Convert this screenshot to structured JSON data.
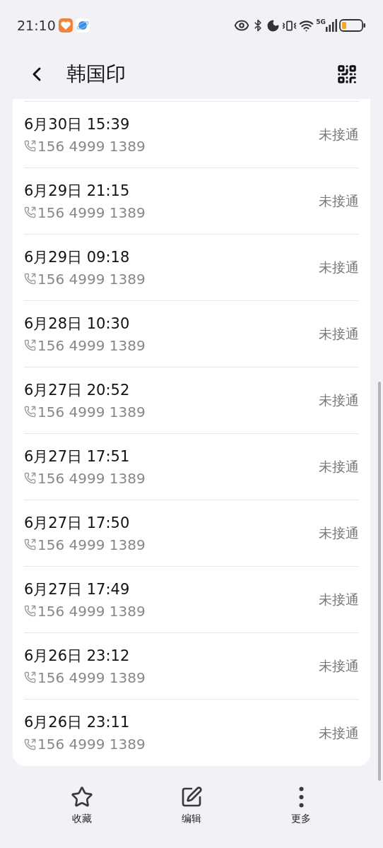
{
  "status_bar": {
    "time": "21:10",
    "network": "5G"
  },
  "header": {
    "title": "韩国印"
  },
  "calls": [
    {
      "date_time": "6月30日 15:39",
      "number": "156 4999 1389",
      "status": "未接通"
    },
    {
      "date_time": "6月29日 21:15",
      "number": "156 4999 1389",
      "status": "未接通"
    },
    {
      "date_time": "6月29日 09:18",
      "number": "156 4999 1389",
      "status": "未接通"
    },
    {
      "date_time": "6月28日 10:30",
      "number": "156 4999 1389",
      "status": "未接通"
    },
    {
      "date_time": "6月27日 20:52",
      "number": "156 4999 1389",
      "status": "未接通"
    },
    {
      "date_time": "6月27日 17:51",
      "number": "156 4999 1389",
      "status": "未接通"
    },
    {
      "date_time": "6月27日 17:50",
      "number": "156 4999 1389",
      "status": "未接通"
    },
    {
      "date_time": "6月27日 17:49",
      "number": "156 4999 1389",
      "status": "未接通"
    },
    {
      "date_time": "6月26日 23:12",
      "number": "156 4999 1389",
      "status": "未接通"
    },
    {
      "date_time": "6月26日 23:11",
      "number": "156 4999 1389",
      "status": "未接通"
    }
  ],
  "bottom_actions": [
    {
      "kind": "star",
      "label": "收藏"
    },
    {
      "kind": "edit",
      "label": "编辑"
    },
    {
      "kind": "more",
      "label": "更多"
    }
  ]
}
